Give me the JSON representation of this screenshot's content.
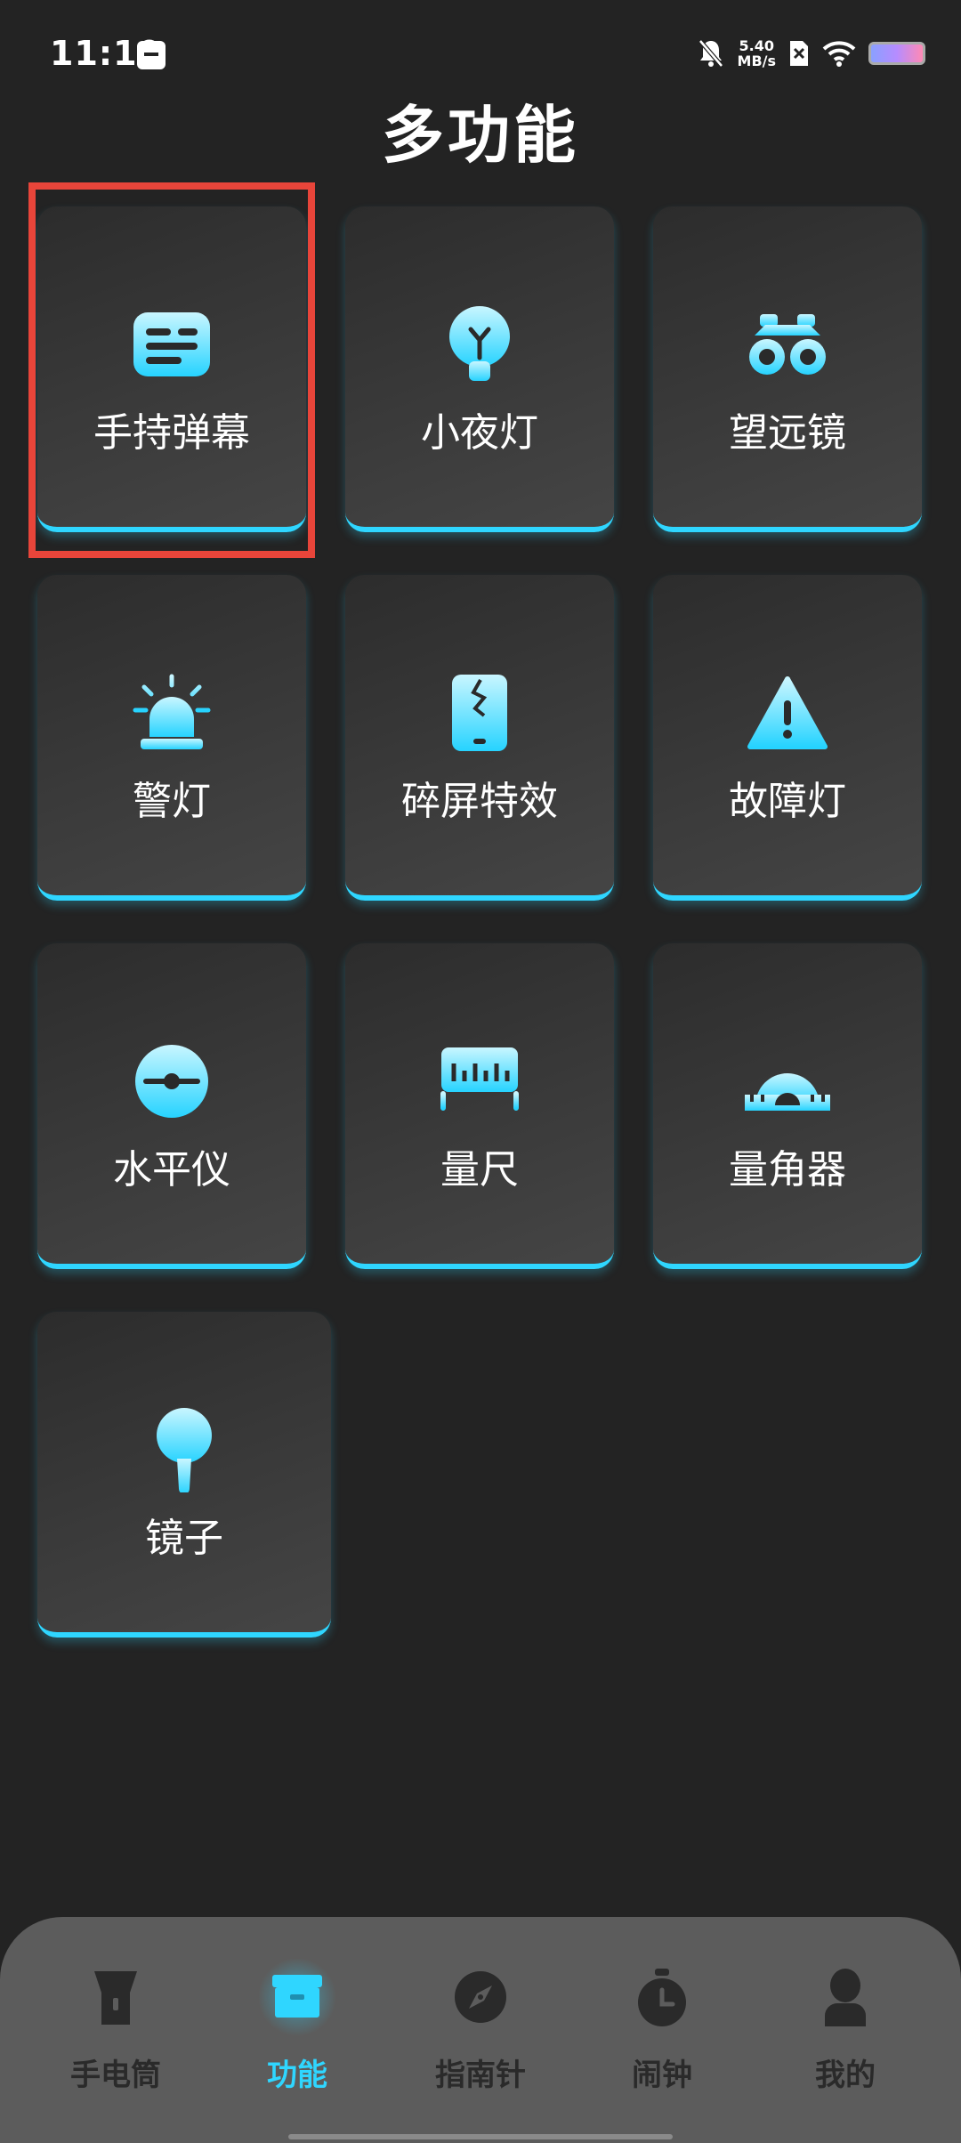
{
  "status": {
    "time": "11:10",
    "net_speed_value": "5.40",
    "net_speed_unit": "MB/s"
  },
  "page": {
    "title": "多功能"
  },
  "features": [
    {
      "label": "手持弹幕",
      "icon": "bullet-screen-icon"
    },
    {
      "label": "小夜灯",
      "icon": "night-light-bulb-icon"
    },
    {
      "label": "望远镜",
      "icon": "binoculars-icon"
    },
    {
      "label": "警灯",
      "icon": "police-siren-icon"
    },
    {
      "label": "碎屏特效",
      "icon": "cracked-screen-icon"
    },
    {
      "label": "故障灯",
      "icon": "warning-triangle-icon"
    },
    {
      "label": "水平仪",
      "icon": "level-icon"
    },
    {
      "label": "量尺",
      "icon": "ruler-icon"
    },
    {
      "label": "量角器",
      "icon": "protractor-icon"
    },
    {
      "label": "镜子",
      "icon": "hand-mirror-icon"
    }
  ],
  "nav": [
    {
      "label": "手电筒",
      "icon": "flashlight-icon"
    },
    {
      "label": "功能",
      "icon": "toolbox-icon",
      "active": true
    },
    {
      "label": "指南针",
      "icon": "compass-icon"
    },
    {
      "label": "闹钟",
      "icon": "alarm-clock-icon"
    },
    {
      "label": "我的",
      "icon": "profile-icon"
    }
  ],
  "colors": {
    "accent": "#2fd6ff",
    "background": "#232323",
    "highlight": "#e8453a"
  }
}
